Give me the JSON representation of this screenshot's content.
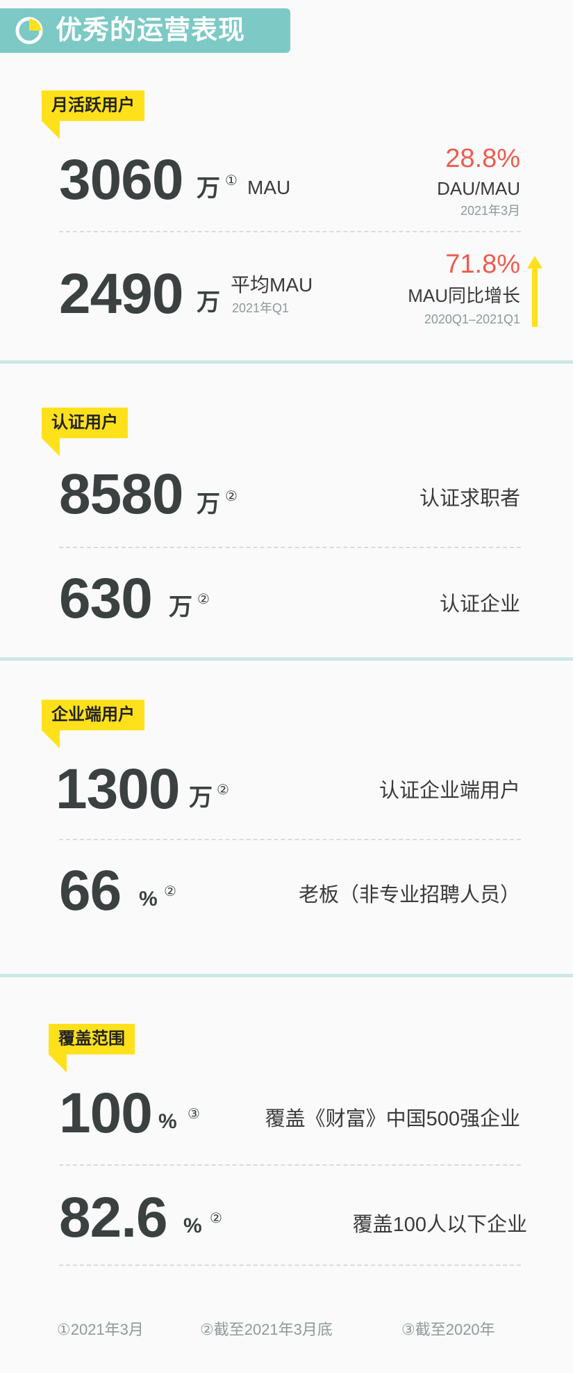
{
  "header": {
    "title": "优秀的运营表现",
    "icon": "pie-chart-icon"
  },
  "mau": {
    "label": "月活跃用户",
    "row1": {
      "number": "3060",
      "unit": "万",
      "note": "①",
      "suffix": "MAU",
      "stat": "28.8%",
      "stat_label": "DAU/MAU",
      "stat_date": "2021年3月"
    },
    "row2": {
      "number": "2490",
      "unit": "万",
      "suffix": "平均MAU",
      "sub": "2021年Q1",
      "stat": "71.8%",
      "stat_label": "MAU同比增长",
      "stat_date": "2020Q1–2021Q1"
    }
  },
  "certified": {
    "label": "认证用户",
    "row1": {
      "number": "8580",
      "unit": "万",
      "note": "②",
      "desc": "认证求职者"
    },
    "row2": {
      "number": "630",
      "unit": "万",
      "note": "②",
      "desc": "认证企业"
    }
  },
  "enterprise": {
    "label": "企业端用户",
    "row1": {
      "number": "1300",
      "unit": "万",
      "note": "②",
      "desc": "认证企业端用户"
    },
    "row2": {
      "number": "66",
      "unit": "%",
      "note": "②",
      "desc": "老板（非专业招聘人员）"
    }
  },
  "coverage": {
    "label": "覆盖范围",
    "row1": {
      "number": "100",
      "unit": "%",
      "note": "③",
      "desc": "覆盖《财富》中国500强企业"
    },
    "row2": {
      "number": "82.6",
      "unit": "%",
      "note": "②",
      "desc": "覆盖100人以下企业"
    }
  },
  "footnotes": [
    "①2021年3月",
    "②截至2021年3月底",
    "③截至2020年"
  ],
  "colors": {
    "teal": "#7cc9c5",
    "yellow": "#ffe11b",
    "red": "#ef5b4f",
    "separator": "#cde8e6"
  }
}
